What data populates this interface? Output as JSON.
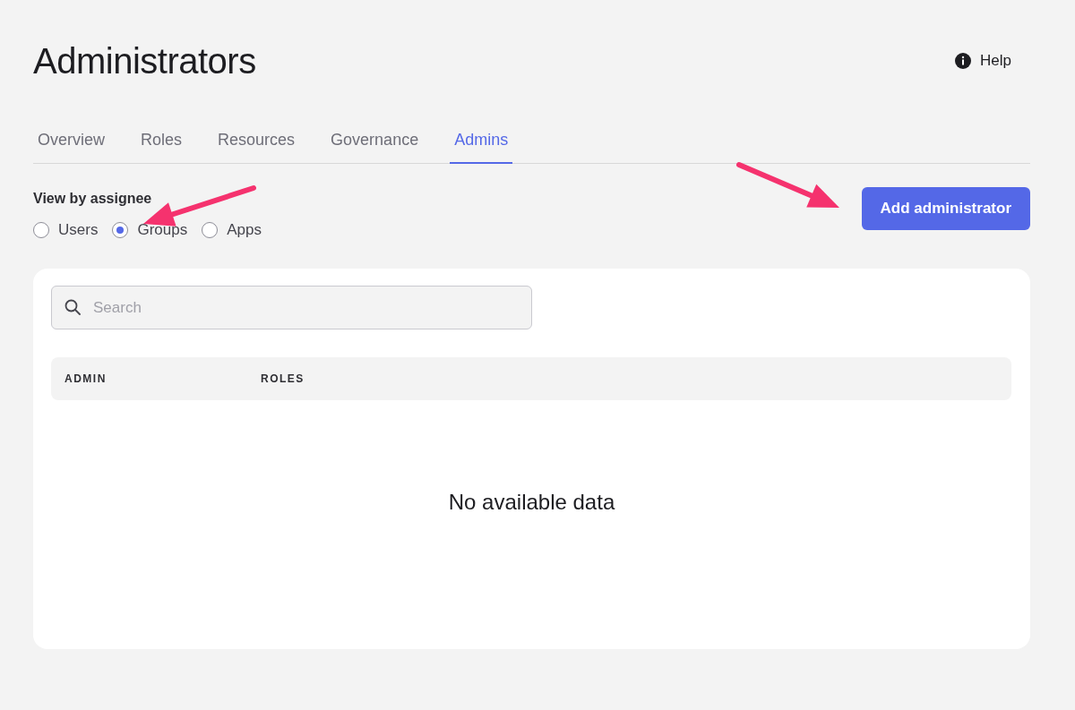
{
  "page": {
    "title": "Administrators",
    "help": "Help"
  },
  "tabs": [
    {
      "label": "Overview",
      "selected": false
    },
    {
      "label": "Roles",
      "selected": false
    },
    {
      "label": "Resources",
      "selected": false
    },
    {
      "label": "Governance",
      "selected": false
    },
    {
      "label": "Admins",
      "selected": true
    }
  ],
  "assignee": {
    "label": "View by assignee",
    "options": [
      {
        "label": "Users",
        "selected": false
      },
      {
        "label": "Groups",
        "selected": true
      },
      {
        "label": "Apps",
        "selected": false
      }
    ]
  },
  "add_button": "Add administrator",
  "search": {
    "placeholder": "Search"
  },
  "table": {
    "columns": [
      "ADMIN",
      "ROLES"
    ],
    "empty": "No available data"
  },
  "annotations": [
    {
      "kind": "arrow"
    },
    {
      "kind": "arrow"
    }
  ]
}
